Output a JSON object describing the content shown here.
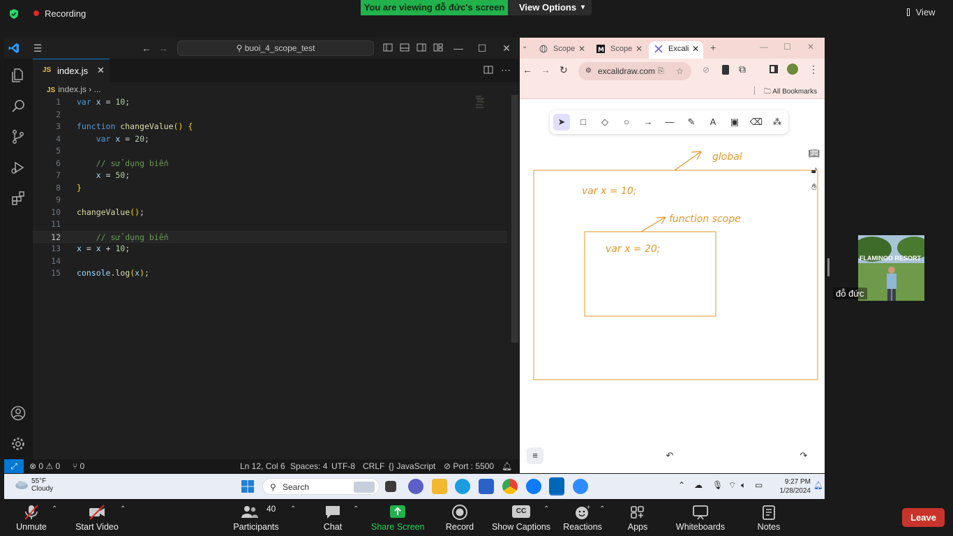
{
  "zoom_top": {
    "recording_label": "Recording",
    "viewing_banner": "You are viewing đỗ đức's screen",
    "view_options": "View Options",
    "view": "View"
  },
  "vscode": {
    "search": "buoi_4_scope_test",
    "tab": {
      "badge": "JS",
      "name": "index.js"
    },
    "breadcrumb": {
      "badge": "JS",
      "file": "index.js",
      "sep": "›",
      "more": "..."
    },
    "code_lines": [
      {
        "n": "1",
        "text": "var x = 10;"
      },
      {
        "n": "2",
        "text": ""
      },
      {
        "n": "3",
        "text": "function changeValue() {"
      },
      {
        "n": "4",
        "text": "    var x = 20;"
      },
      {
        "n": "5",
        "text": ""
      },
      {
        "n": "6",
        "text": "    // sử dụng biến"
      },
      {
        "n": "7",
        "text": "    x = 50;"
      },
      {
        "n": "8",
        "text": "}"
      },
      {
        "n": "9",
        "text": ""
      },
      {
        "n": "10",
        "text": "changeValue();"
      },
      {
        "n": "11",
        "text": ""
      },
      {
        "n": "12",
        "text": "    // sử dụng biến"
      },
      {
        "n": "13",
        "text": "x = x + 10;"
      },
      {
        "n": "14",
        "text": ""
      },
      {
        "n": "15",
        "text": "console.log(x);"
      }
    ],
    "status": {
      "problems": "⊗ 0 ⚠ 0",
      "ports": "⑂ 0",
      "position": "Ln 12, Col 6",
      "spaces": "Spaces: 4",
      "encoding": "UTF-8",
      "eol": "CRLF",
      "language": "{} JavaScript",
      "port": "⊘ Port : 5500"
    }
  },
  "browser": {
    "tabs": [
      {
        "label": "Scope"
      },
      {
        "label": "Scope"
      },
      {
        "label": "Excali"
      }
    ],
    "url": "excalidraw.com",
    "bookmarks_label": "All Bookmarks",
    "canvas": {
      "label_global": "global",
      "code_global": "var x = 10;",
      "label_function": "function scope",
      "code_function": "var x = 20;"
    }
  },
  "participant": {
    "name": "đỗ đức",
    "sign": "FLAMINGO RESORT"
  },
  "taskbar": {
    "temp": "55°F",
    "weather": "Cloudy",
    "search": "Search",
    "time": "9:27 PM",
    "date": "1/28/2024"
  },
  "zoom_bottom": {
    "unmute": "Unmute",
    "start_video": "Start Video",
    "participants": "Participants",
    "participants_count": "40",
    "chat": "Chat",
    "share_screen": "Share Screen",
    "record": "Record",
    "captions": "Show Captions",
    "captions_badge": "CC",
    "reactions": "Reactions",
    "apps": "Apps",
    "whiteboards": "Whiteboards",
    "notes": "Notes",
    "leave": "Leave"
  },
  "colors": {
    "banner_green": "#21b24b",
    "vscode_accent": "#0078d4",
    "excalidraw_stroke": "#e8962a",
    "leave_red": "#c8342b",
    "browser_tab_bar": "#f6d9d4"
  }
}
